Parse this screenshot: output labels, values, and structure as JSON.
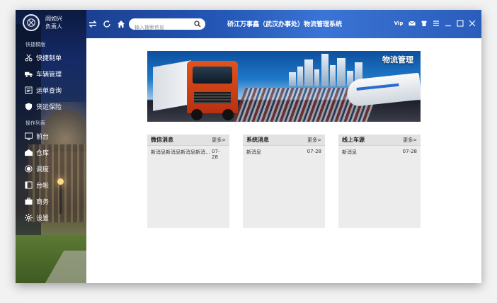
{
  "app": {
    "title": "硚江万事鑫（武汉办事处）物流管理系统"
  },
  "profile": {
    "name": "阎如兴",
    "role": "负责人",
    "icon": "user-avatar-icon"
  },
  "sidebar": {
    "sections": [
      {
        "label": "快捷模版"
      },
      {
        "label": "操作列表"
      }
    ],
    "items": [
      {
        "label": "快捷制单",
        "icon": "scissors-icon"
      },
      {
        "label": "车辆管理",
        "icon": "truck-icon"
      },
      {
        "label": "运单查询",
        "icon": "document-icon"
      },
      {
        "label": "货运保险",
        "icon": "shield-icon"
      },
      {
        "label": "前台",
        "icon": "monitor-icon"
      },
      {
        "label": "仓库",
        "icon": "warehouse-icon"
      },
      {
        "label": "调度",
        "icon": "gear-network-icon"
      },
      {
        "label": "台帐",
        "icon": "ledger-icon"
      },
      {
        "label": "商务",
        "icon": "briefcase-icon"
      },
      {
        "label": "设置",
        "icon": "settings-icon"
      }
    ]
  },
  "search": {
    "placeholder": "输入搜索信息"
  },
  "banner": {
    "label": "物流管理"
  },
  "panels": [
    {
      "title": "微信消息",
      "more": "更多>",
      "rows": [
        {
          "text": "新消息新消息新消息新消息新消息",
          "date": "07-28"
        }
      ]
    },
    {
      "title": "系统消息",
      "more": "更多>",
      "rows": [
        {
          "text": "新消息",
          "date": "07-28"
        }
      ]
    },
    {
      "title": "线上车源",
      "more": "更多>",
      "rows": [
        {
          "text": "新消息",
          "date": "07-28"
        }
      ]
    }
  ],
  "header_right": {
    "vip_label": "Vip"
  },
  "colors": {
    "header": "#2458b8",
    "panel_bg": "#ececec"
  }
}
